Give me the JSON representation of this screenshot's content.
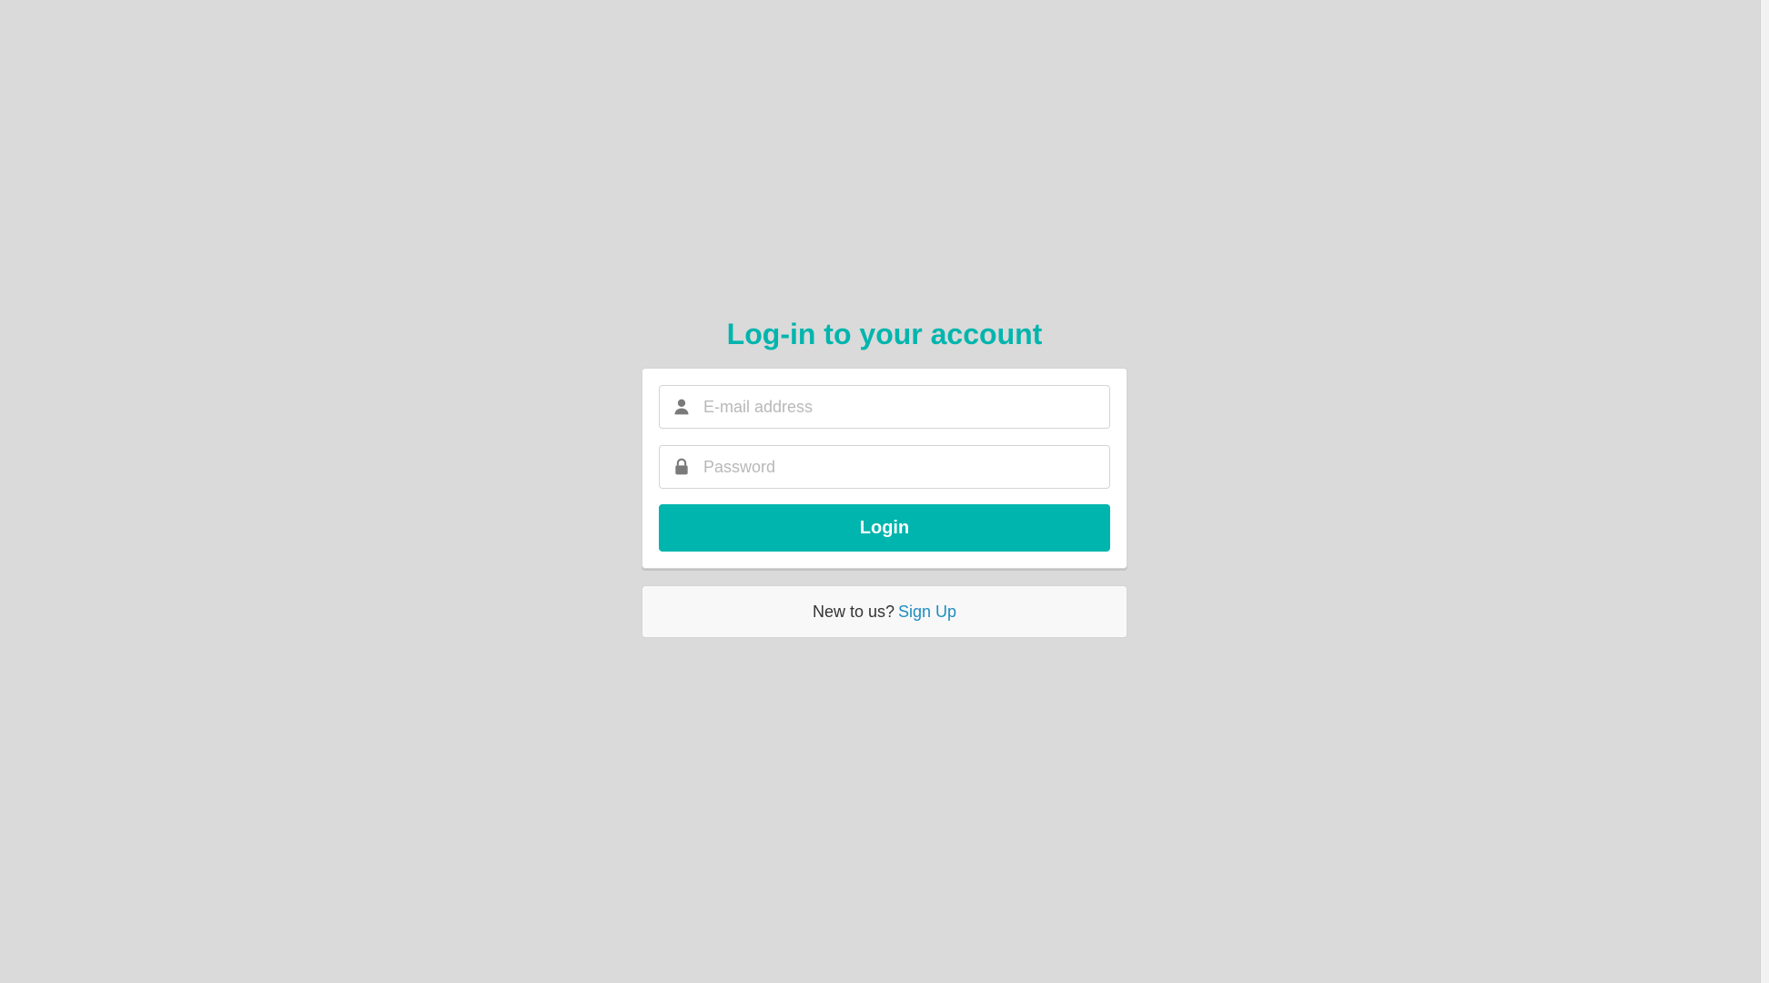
{
  "page": {
    "title": "Log-in to your account"
  },
  "form": {
    "email_placeholder": "E-mail address",
    "email_value": "",
    "password_placeholder": "Password",
    "password_value": "",
    "submit_label": "Login"
  },
  "signup": {
    "prompt": "New to us?",
    "link_label": "Sign Up"
  },
  "icons": {
    "email": "user-icon",
    "password": "lock-icon"
  },
  "colors": {
    "accent": "#00b5ad",
    "background": "#dadada",
    "link": "#1f8dbf",
    "panel": "#f8f8f9"
  }
}
